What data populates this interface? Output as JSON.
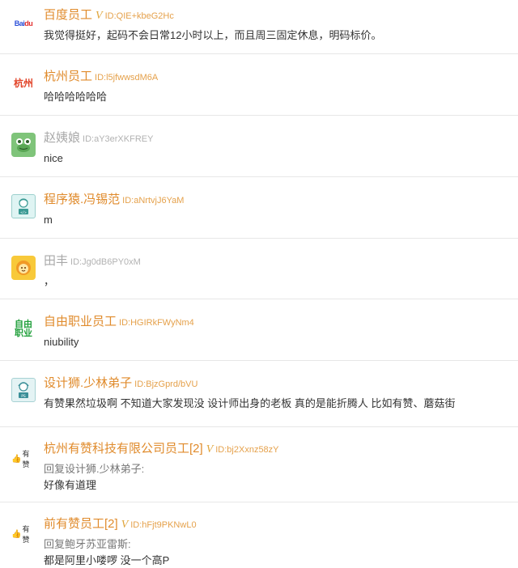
{
  "comments": [
    {
      "name": "百度员工",
      "verified": true,
      "v_mark": "V",
      "uid": "ID:QIE+kbeG2Hc",
      "text": "我觉得挺好，起码不会日常12小时以上，而且周三固定休息，明码标价。",
      "avatar": {
        "icon": "baidu-logo-icon",
        "label_left": "Bai",
        "label_right": "du"
      }
    },
    {
      "name": "杭州员工",
      "verified": false,
      "uid": "ID:l5jfwwsdM6A",
      "text": "哈哈哈哈哈哈",
      "avatar": {
        "icon": "hangzhou-logo-icon",
        "label": "杭州"
      }
    },
    {
      "name": "赵姨娘",
      "verified": false,
      "uid": "ID:aY3erXKFREY",
      "text": "nice",
      "avatar": {
        "icon": "frog-icon"
      }
    },
    {
      "name": "程序猿.冯锡范",
      "verified": false,
      "uid": "ID:aNrtvjJ6YaM",
      "text": "m",
      "avatar": {
        "icon": "programmer-icon"
      }
    },
    {
      "name": "田丰",
      "verified": false,
      "uid": "ID:Jg0dB6PY0xM",
      "text": "，",
      "avatar": {
        "icon": "lion-icon"
      }
    },
    {
      "name": "自由职业员工",
      "verified": false,
      "uid": "ID:HGIRkFWyNm4",
      "text": "niubility",
      "avatar": {
        "icon": "freelance-logo-icon",
        "line1": "自由",
        "line2": "职业"
      }
    },
    {
      "name": "设计狮.少林弟子",
      "verified": false,
      "uid": "ID:BjzGprd/bVU",
      "text": "有赞果然垃圾啊 不知道大家发现没 设计师出身的老板 真的是能折腾人 比如有赞、蘑菇街",
      "avatar": {
        "icon": "designer-icon"
      }
    },
    {
      "name": "杭州有赞科技有限公司员工[2]",
      "verified": true,
      "v_mark": "V",
      "uid": "ID:bj2Xxnz58zY",
      "reply_to": "回复设计狮.少林弟子:",
      "text": "好像有道理",
      "avatar": {
        "icon": "youzan-logo-icon",
        "label": "有赞"
      }
    },
    {
      "name": "前有赞员工[2]",
      "verified": true,
      "v_mark": "V",
      "uid": "ID:hFjt9PKNwL0",
      "reply_to": "回复鲍牙苏亚雷斯:",
      "text": "都是阿里小喽啰 没一个高P",
      "avatar": {
        "icon": "youzan-logo-icon",
        "label": "有赞"
      }
    }
  ]
}
